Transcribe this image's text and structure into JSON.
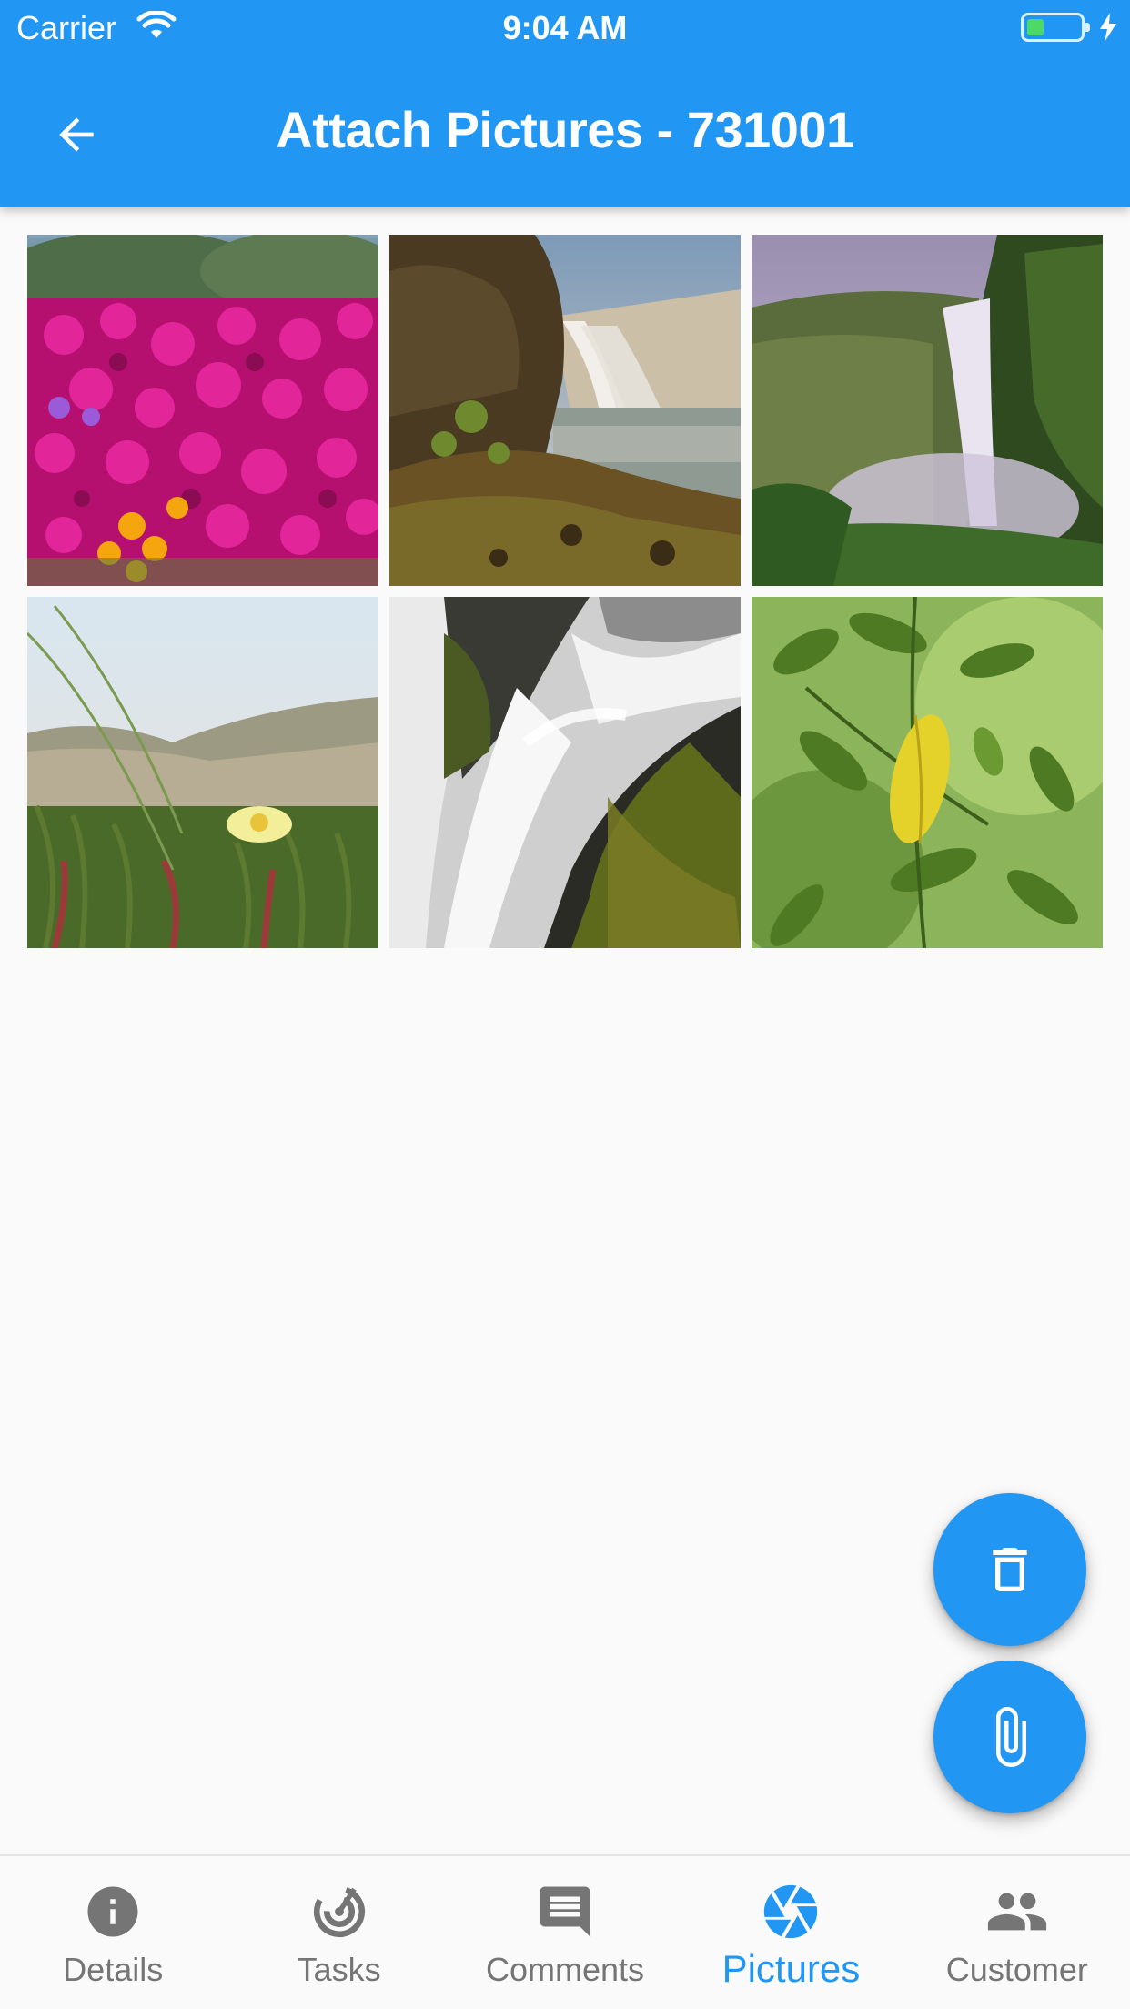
{
  "status_bar": {
    "carrier": "Carrier",
    "time": "9:04 AM",
    "battery_color": "#4cd964"
  },
  "app_bar": {
    "title": "Attach Pictures - 731001",
    "back_icon": "arrow-back-icon",
    "background": "#2196f3"
  },
  "photos": [
    {
      "subject": "pink-flower-field"
    },
    {
      "subject": "waterfall-cliffside"
    },
    {
      "subject": "misty-waterfall-canyon"
    },
    {
      "subject": "yellow-flower-grass"
    },
    {
      "subject": "waterfall-mossy-rocks"
    },
    {
      "subject": "green-leaves-yellow-leaf"
    }
  ],
  "fabs": {
    "delete_icon": "trash-icon",
    "attach_icon": "paperclip-icon",
    "color": "#2196f3"
  },
  "bottom_nav": {
    "items": [
      {
        "label": "Details",
        "icon": "info-icon"
      },
      {
        "label": "Tasks",
        "icon": "tasks-icon"
      },
      {
        "label": "Comments",
        "icon": "comment-icon"
      },
      {
        "label": "Pictures",
        "icon": "camera-aperture-icon"
      },
      {
        "label": "Customer",
        "icon": "people-icon"
      }
    ],
    "active": "Pictures",
    "active_color": "#2196f3",
    "inactive_color": "#757575"
  }
}
